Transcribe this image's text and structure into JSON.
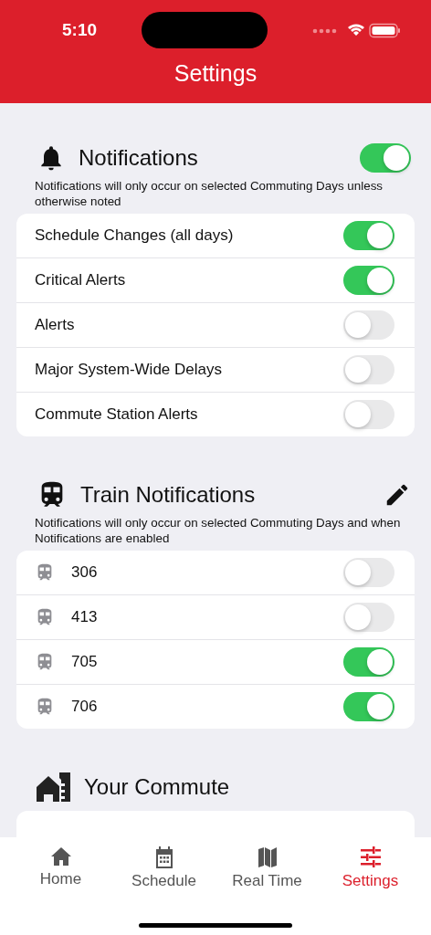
{
  "status_bar": {
    "time": "5:10"
  },
  "header": {
    "title": "Settings"
  },
  "sections": [
    {
      "kind": "general",
      "title": "Notifications",
      "on": true,
      "note": "Notifications will only occur on selected Commuting Days unless otherwise noted",
      "items": [
        {
          "label": "Schedule Changes (all days)",
          "on": true
        },
        {
          "label": "Critical Alerts",
          "on": true
        },
        {
          "label": "Alerts",
          "on": false
        },
        {
          "label": "Major System-Wide Delays",
          "on": false
        },
        {
          "label": "Commute Station Alerts",
          "on": false
        }
      ]
    },
    {
      "kind": "trains",
      "title": "Train Notifications",
      "note": "Notifications will only occur on selected Commuting Days and when Notifications are enabled",
      "items": [
        {
          "label": "306",
          "on": false
        },
        {
          "label": "413",
          "on": false
        },
        {
          "label": "705",
          "on": true
        },
        {
          "label": "706",
          "on": true
        }
      ]
    },
    {
      "kind": "commute",
      "title": "Your Commute"
    }
  ],
  "tab_bar": [
    {
      "label": "Home",
      "selected": false
    },
    {
      "label": "Schedule",
      "selected": false
    },
    {
      "label": "Real Time",
      "selected": false
    },
    {
      "label": "Settings",
      "selected": true
    }
  ]
}
